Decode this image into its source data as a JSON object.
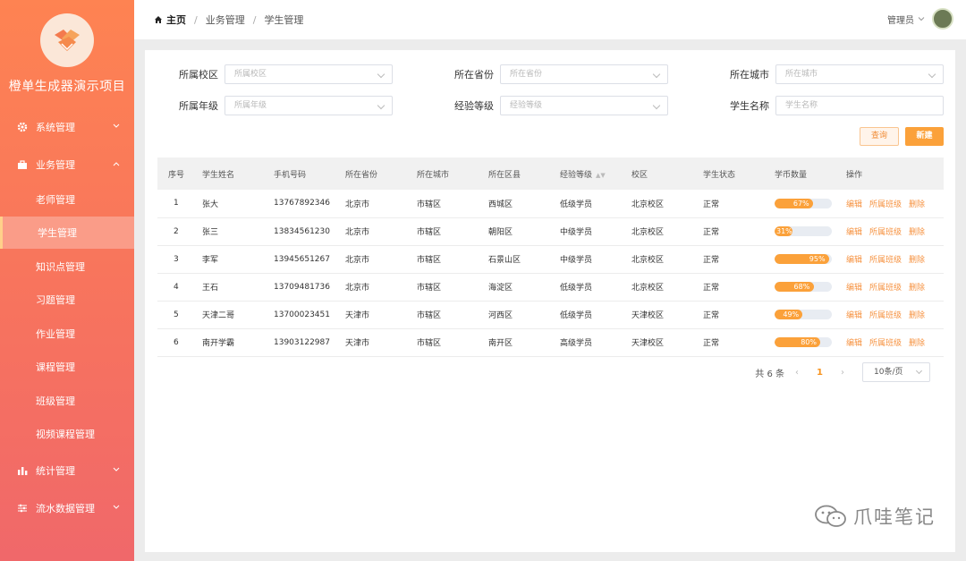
{
  "app": {
    "title": "橙单生成器演示项目"
  },
  "sidebar": {
    "menus": [
      {
        "label": "系统管理",
        "icon": "gear-icon"
      },
      {
        "label": "业务管理",
        "icon": "briefcase-icon"
      },
      {
        "label": "统计管理",
        "icon": "bar-chart-icon"
      },
      {
        "label": "流水数据管理",
        "icon": "sliders-icon"
      }
    ],
    "sub_items": [
      "老师管理",
      "学生管理",
      "知识点管理",
      "习题管理",
      "作业管理",
      "课程管理",
      "班级管理",
      "视频课程管理"
    ]
  },
  "breadcrumb": {
    "home": "主页",
    "level1": "业务管理",
    "level2": "学生管理"
  },
  "header": {
    "user": "管理员"
  },
  "filters": {
    "school": {
      "label": "所属校区",
      "placeholder": "所属校区"
    },
    "province": {
      "label": "所在省份",
      "placeholder": "所在省份"
    },
    "city": {
      "label": "所在城市",
      "placeholder": "所在城市"
    },
    "grade": {
      "label": "所属年级",
      "placeholder": "所属年级"
    },
    "level": {
      "label": "经验等级",
      "placeholder": "经验等级"
    },
    "name": {
      "label": "学生名称",
      "placeholder": "学生名称"
    }
  },
  "buttons": {
    "query": "查询",
    "create": "新建"
  },
  "table": {
    "columns": [
      "序号",
      "学生姓名",
      "手机号码",
      "所在省份",
      "所在城市",
      "所在区县",
      "经验等级",
      "校区",
      "学生状态",
      "学币数量",
      "操作"
    ],
    "actions": [
      "编辑",
      "所属班级",
      "删除"
    ],
    "rows": [
      {
        "idx": "1",
        "name": "张大",
        "phone": "13767892346",
        "province": "北京市",
        "city": "市辖区",
        "district": "西城区",
        "level": "低级学员",
        "school": "北京校区",
        "status": "正常",
        "coins": 67,
        "coins_label": "67%"
      },
      {
        "idx": "2",
        "name": "张三",
        "phone": "13834561230",
        "province": "北京市",
        "city": "市辖区",
        "district": "朝阳区",
        "level": "中级学员",
        "school": "北京校区",
        "status": "正常",
        "coins": 31,
        "coins_label": "31%"
      },
      {
        "idx": "3",
        "name": "李军",
        "phone": "13945651267",
        "province": "北京市",
        "city": "市辖区",
        "district": "石景山区",
        "level": "中级学员",
        "school": "北京校区",
        "status": "正常",
        "coins": 95,
        "coins_label": "95%"
      },
      {
        "idx": "4",
        "name": "王石",
        "phone": "13709481736",
        "province": "北京市",
        "city": "市辖区",
        "district": "海淀区",
        "level": "低级学员",
        "school": "北京校区",
        "status": "正常",
        "coins": 68,
        "coins_label": "68%"
      },
      {
        "idx": "5",
        "name": "天津二哥",
        "phone": "13700023451",
        "province": "天津市",
        "city": "市辖区",
        "district": "河西区",
        "level": "低级学员",
        "school": "天津校区",
        "status": "正常",
        "coins": 49,
        "coins_label": "49%"
      },
      {
        "idx": "6",
        "name": "南开学霸",
        "phone": "13903122987",
        "province": "天津市",
        "city": "市辖区",
        "district": "南开区",
        "level": "高级学员",
        "school": "天津校区",
        "status": "正常",
        "coins": 80,
        "coins_label": "80%"
      }
    ]
  },
  "pagination": {
    "total": "共 6 条",
    "current": "1",
    "page_size": "10条/页"
  },
  "watermark": {
    "text": "爪哇笔记"
  },
  "colors": {
    "accent": "#fba13a",
    "sidebar_top": "#fe8352",
    "sidebar_bottom": "#f0686a"
  }
}
